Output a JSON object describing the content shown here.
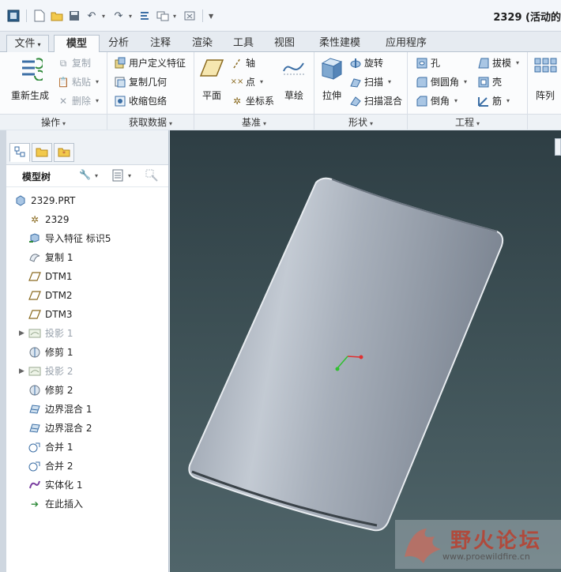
{
  "window": {
    "title": "2329 (活动的"
  },
  "qat": {
    "icons": [
      "window-icon",
      "new-icon",
      "open-icon",
      "save-icon",
      "undo-icon",
      "redo-icon",
      "regenerate-icon",
      "windows-icon",
      "close-window-icon",
      "customize-icon"
    ]
  },
  "tabs": [
    "文件",
    "模型",
    "分析",
    "注释",
    "渲染",
    "工具",
    "视图",
    "柔性建模",
    "应用程序"
  ],
  "active_tab": "模型",
  "ribbon": {
    "operations": {
      "label": "操作",
      "regenerate": "重新生成",
      "copy": "复制",
      "paste": "粘贴",
      "delete": "删除"
    },
    "get_data": {
      "label": "获取数据",
      "udf": "用户定义特征",
      "copy_geom": "复制几何",
      "shrinkwrap": "收缩包络"
    },
    "datum": {
      "label": "基准",
      "plane": "平面",
      "axis": "轴",
      "point": "点",
      "csys": "坐标系",
      "sketch": "草绘"
    },
    "shapes": {
      "label": "形状",
      "extrude": "拉伸",
      "revolve": "旋转",
      "sweep": "扫描",
      "swept_blend": "扫描混合"
    },
    "engineering": {
      "label": "工程",
      "hole": "孔",
      "round": "倒圆角",
      "chamfer": "倒角",
      "draft": "拔模",
      "shell": "壳",
      "rib": "筋"
    },
    "editing": {
      "pattern": "阵列"
    }
  },
  "model_tree": {
    "title": "模型树",
    "items": [
      {
        "label": "2329.PRT",
        "icon": "part-icon"
      },
      {
        "label": "2329",
        "icon": "csys-icon"
      },
      {
        "label": "导入特征 标识5",
        "icon": "import-feature-icon"
      },
      {
        "label": "复制 1",
        "icon": "copy-surface-icon"
      },
      {
        "label": "DTM1",
        "icon": "datum-plane-icon"
      },
      {
        "label": "DTM2",
        "icon": "datum-plane-icon"
      },
      {
        "label": "DTM3",
        "icon": "datum-plane-icon"
      },
      {
        "label": "投影 1",
        "icon": "projection-icon"
      },
      {
        "label": "修剪 1",
        "icon": "trim-icon"
      },
      {
        "label": "投影 2",
        "icon": "projection-icon"
      },
      {
        "label": "修剪 2",
        "icon": "trim-icon"
      },
      {
        "label": "边界混合 1",
        "icon": "boundary-blend-icon"
      },
      {
        "label": "边界混合 2",
        "icon": "boundary-blend-icon"
      },
      {
        "label": "合并 1",
        "icon": "merge-icon"
      },
      {
        "label": "合并 2",
        "icon": "merge-icon"
      },
      {
        "label": "实体化 1",
        "icon": "solidify-icon"
      },
      {
        "label": "在此插入",
        "icon": "insert-here-icon"
      }
    ]
  },
  "watermark": {
    "title": "野火论坛",
    "url": "www.proewildfire.cn"
  },
  "colors": {
    "viewport_top": "#2e3e44",
    "viewport_bottom": "#50656a",
    "model_surface": "#a5adb8",
    "csys_x": "#e03030",
    "csys_y": "#30c030",
    "watermark_text": "#b04a3c"
  }
}
